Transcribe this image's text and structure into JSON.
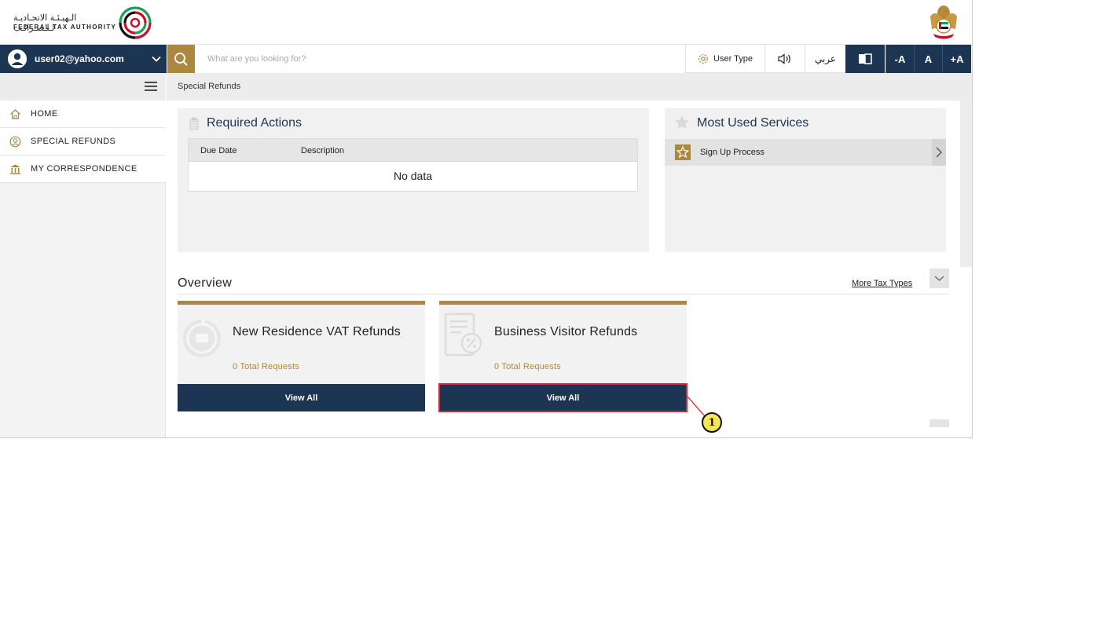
{
  "header": {
    "logo_arabic": "الـهيـئـة الاتحـاديـة لـلـضـرائـب",
    "logo_english": "FEDERAL TAX AUTHORITY"
  },
  "navbar": {
    "user_email": "user02@yahoo.com",
    "search_placeholder": "What are you looking for?",
    "user_type_label": "User Type",
    "language_label": "عربي",
    "font_decrease": "-A",
    "font_regular": "A",
    "font_increase": "+A"
  },
  "sidebar": {
    "items": [
      {
        "label": "HOME",
        "icon": "home-icon"
      },
      {
        "label": "SPECIAL REFUNDS",
        "icon": "user-circle-icon"
      },
      {
        "label": "MY CORRESPONDENCE",
        "icon": "bank-icon"
      }
    ]
  },
  "breadcrumb": "Special Refunds",
  "required_actions": {
    "title": "Required Actions",
    "columns": [
      "Due Date",
      "Description"
    ],
    "empty_text": "No data"
  },
  "most_used_services": {
    "title": "Most Used Services",
    "items": [
      "Sign Up Process"
    ]
  },
  "overview": {
    "title": "Overview",
    "more_link": "More Tax Types",
    "cards": [
      {
        "title": "New Residence VAT Refunds",
        "count_text": "0 Total Requests",
        "button": "View All"
      },
      {
        "title": "Business Visitor Refunds",
        "count_text": "0 Total Requests",
        "button": "View All"
      }
    ]
  },
  "annotation": {
    "label": "1"
  },
  "colors": {
    "navy": "#1c3553",
    "gold": "#ac8740",
    "highlight_red": "#e0232e",
    "callout_yellow": "#f6e55b"
  }
}
